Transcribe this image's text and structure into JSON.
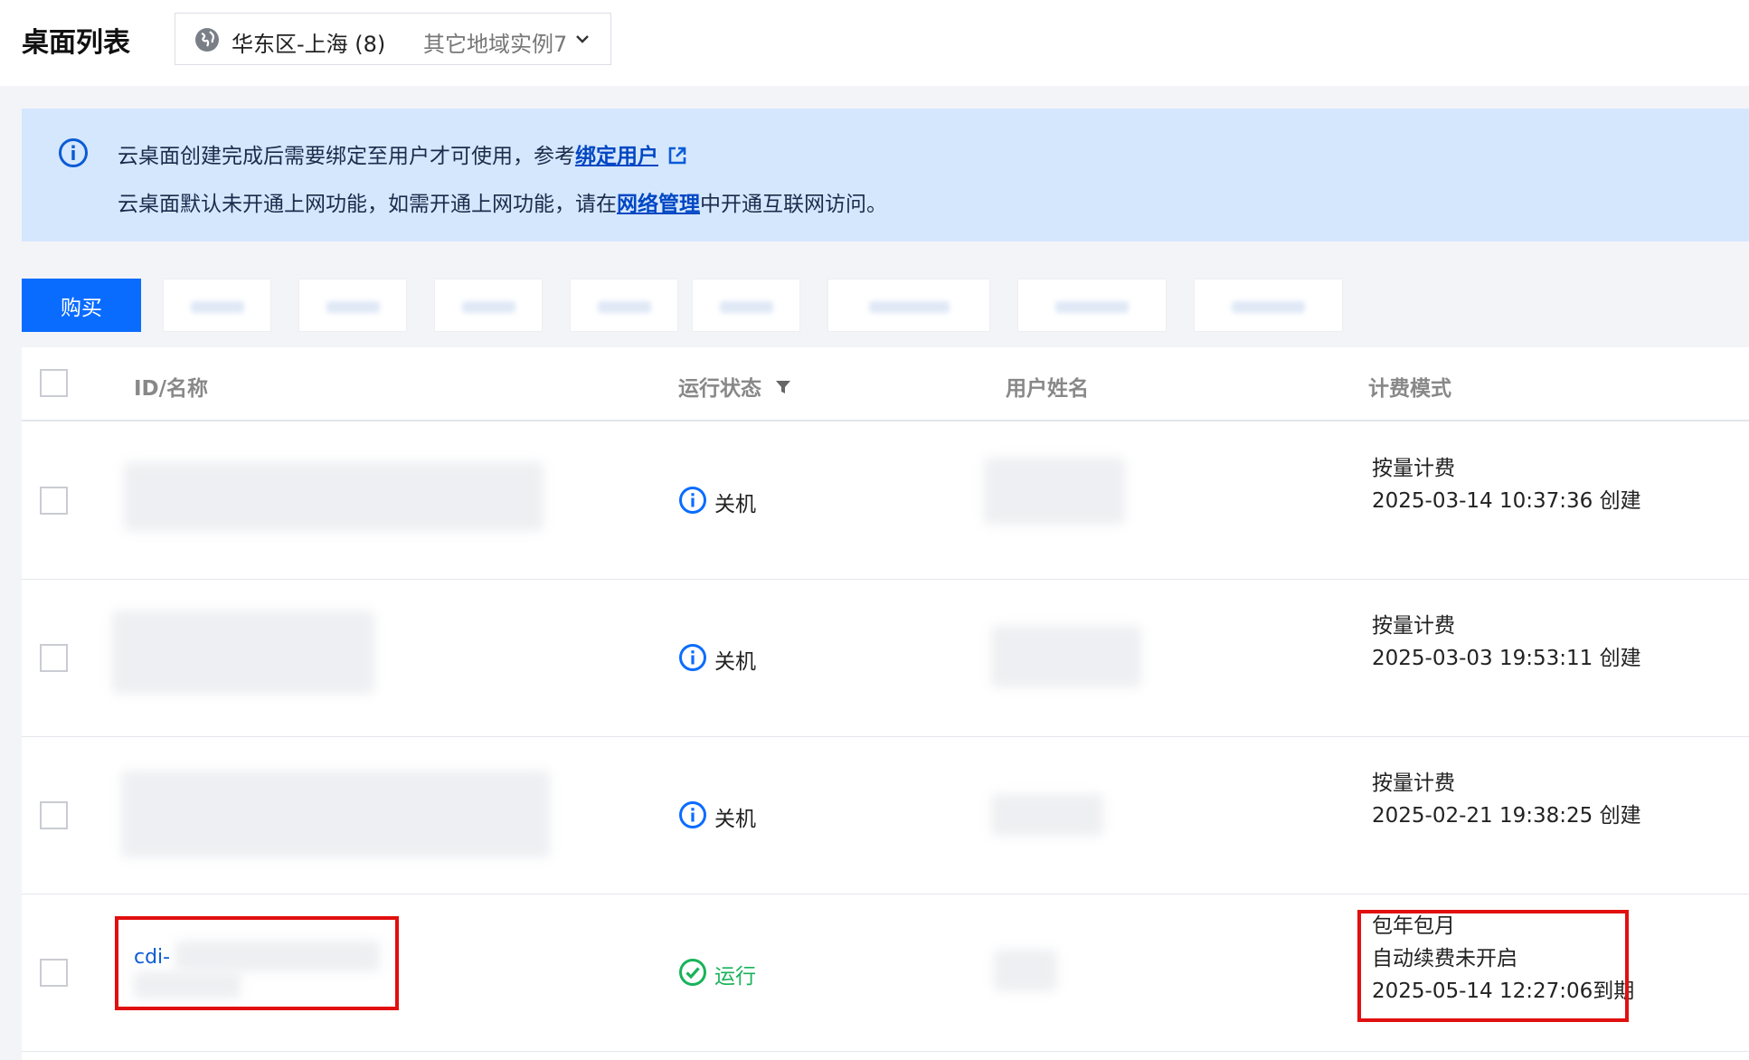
{
  "header": {
    "title": "桌面列表",
    "region": "华东区-上海 (8)",
    "other_regions": "其它地域实例7"
  },
  "notice": {
    "line1_text": "云桌面创建完成后需要绑定至用户才可使用，参考",
    "line1_link": "绑定用户",
    "line2_prefix": "云桌面默认未开通上网功能，如需开通上网功能，请在",
    "line2_link": "网络管理",
    "line2_suffix": "中开通互联网访问。"
  },
  "toolbar": {
    "buy_label": "购买"
  },
  "table": {
    "columns": {
      "id_name": "ID/名称",
      "status": "运行状态",
      "user_name": "用户姓名",
      "billing": "计费模式"
    },
    "rows": [
      {
        "id": "",
        "status": "关机",
        "billing_mode": "按量计费",
        "billing_detail": "2025-03-14 10:37:36 创建",
        "billing_extra": ""
      },
      {
        "id": "",
        "status": "关机",
        "billing_mode": "按量计费",
        "billing_detail": "2025-03-03 19:53:11 创建",
        "billing_extra": ""
      },
      {
        "id": "",
        "status": "关机",
        "billing_mode": "按量计费",
        "billing_detail": "2025-02-21 19:38:25 创建",
        "billing_extra": ""
      },
      {
        "id": "cdi-",
        "status": "运行",
        "billing_mode": "包年包月",
        "billing_extra": "自动续费未开启",
        "billing_detail": "2025-05-14 12:27:06到期"
      }
    ]
  },
  "colors": {
    "primary": "#0a6cff",
    "notice_bg": "#d5e7fd",
    "running": "#18b35a",
    "highlight": "#e10f0f"
  }
}
